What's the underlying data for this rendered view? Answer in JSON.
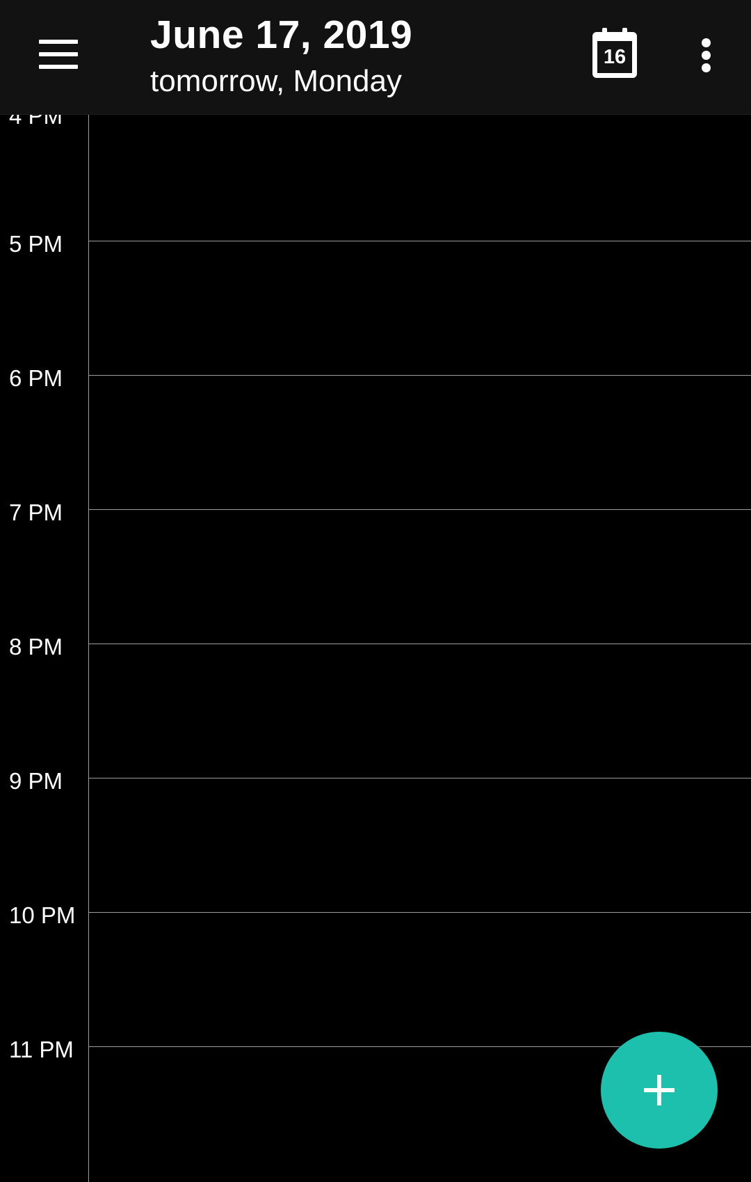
{
  "app_bar": {
    "menu_icon": "hamburger-menu-icon",
    "title": "June 17, 2019",
    "subtitle": "tomorrow, Monday",
    "today_icon": "calendar-today-icon",
    "today_day": "16",
    "overflow_icon": "more-vertical-icon",
    "background_color": "#121212"
  },
  "timeline": {
    "partial_label": "4 PM",
    "hours": [
      {
        "label": "5 PM"
      },
      {
        "label": "6 PM"
      },
      {
        "label": "7 PM"
      },
      {
        "label": "8 PM"
      },
      {
        "label": "9 PM"
      },
      {
        "label": "10 PM"
      },
      {
        "label": "11 PM"
      }
    ],
    "line_color": "#9e9e9e",
    "background_color": "#000000"
  },
  "fab": {
    "icon": "plus-icon",
    "color": "#1dbfad"
  }
}
